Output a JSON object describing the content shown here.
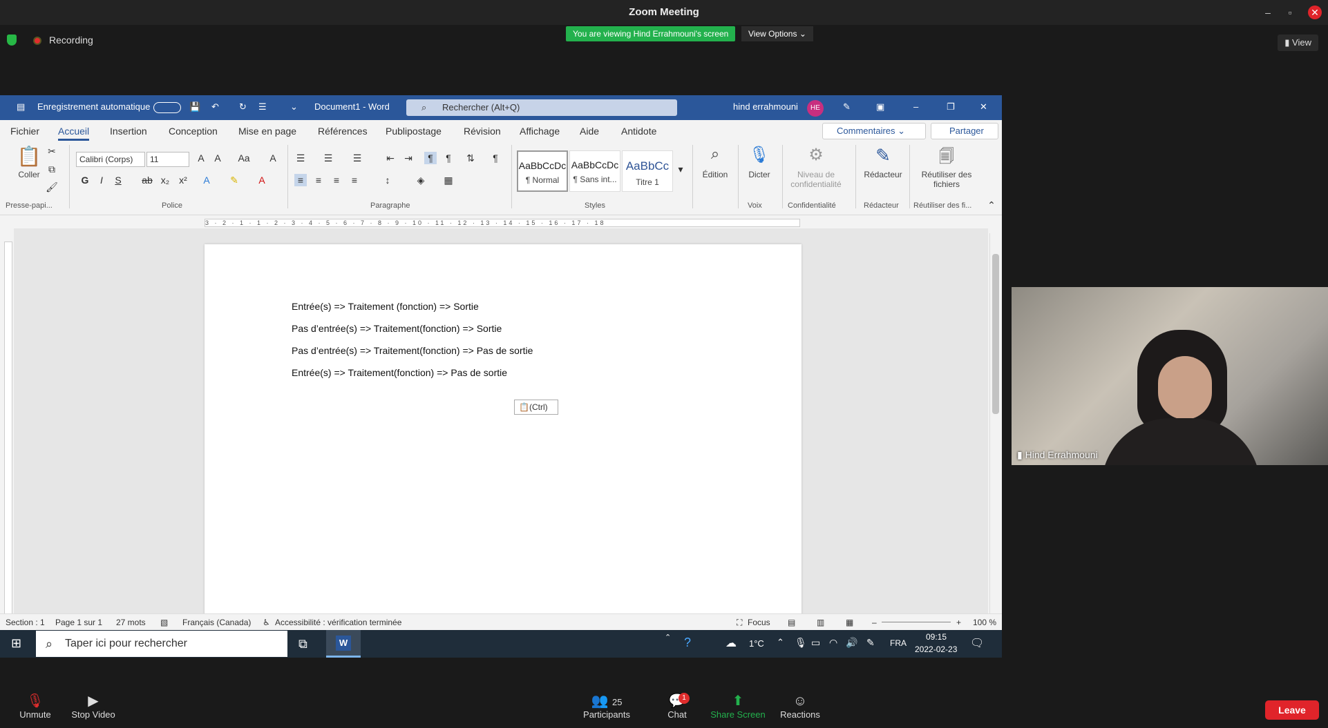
{
  "zoom": {
    "title": "Zoom Meeting",
    "recording_label": "Recording",
    "viewing_banner": "You are viewing Hind Errahmouni's screen",
    "view_options": "View Options",
    "view_top": "View",
    "participant_name": "Hind Errahmouni",
    "footer": {
      "unmute": "Unmute",
      "stop_video": "Stop Video",
      "participants": "Participants",
      "participants_count": "25",
      "chat": "Chat",
      "chat_badge": "1",
      "share_screen": "Share Screen",
      "reactions": "Reactions",
      "leave": "Leave"
    }
  },
  "word": {
    "autosave_label": "Enregistrement automatique",
    "doc_title": "Document1 - Word",
    "search_placeholder": "Rechercher (Alt+Q)",
    "user_name": "hind errahmouni",
    "user_initials": "HE",
    "tabs": [
      "Fichier",
      "Accueil",
      "Insertion",
      "Conception",
      "Mise en page",
      "Références",
      "Publipostage",
      "Révision",
      "Affichage",
      "Aide",
      "Antidote"
    ],
    "active_tab": "Accueil",
    "comments_btn": "Commentaires",
    "share_btn": "Partager",
    "ribbon": {
      "paste": "Coller",
      "clipboard_group": "Presse-papi...",
      "font_name": "Calibri (Corps)",
      "font_size": "11",
      "font_group": "Police",
      "paragraph_group": "Paragraphe",
      "styles": [
        {
          "preview": "AaBbCcDc",
          "name": "¶ Normal"
        },
        {
          "preview": "AaBbCcDc",
          "name": "¶ Sans int..."
        },
        {
          "preview": "AaBbCc",
          "name": "Titre 1"
        }
      ],
      "styles_group": "Styles",
      "editing": "Édition",
      "dictate": "Dicter",
      "voice_group": "Voix",
      "sensitivity": "Niveau de confidentialité",
      "confidentiality_group": "Confidentialité",
      "editor": "Rédacteur",
      "editor_group": "Rédacteur",
      "reuse": "Réutiliser des fichiers",
      "reuse_group": "Réutiliser des fi..."
    },
    "ruler_text": "3 · 2 · 1 · 1 · 2 · 3 · 4 · 5 · 6 · 7 · 8 · 9 · 10 · 11 · 12 · 13 · 14 · 15 · 16 · 17 · 18",
    "paragraphs": [
      "Entrée(s) => Traitement (fonction) => Sortie",
      "Pas d’entrée(s) => Traitement(fonction) => Sortie",
      "Pas d’entrée(s) => Traitement(fonction) => Pas de sortie",
      "Entrée(s) =>  Traitement(fonction) => Pas de sortie"
    ],
    "paste_options": "(Ctrl)",
    "status": {
      "section": "Section : 1",
      "page": "Page 1 sur 1",
      "words": "27 mots",
      "language": "Français (Canada)",
      "accessibility": "Accessibilité : vérification terminée",
      "focus": "Focus",
      "zoom": "100 %"
    }
  },
  "taskbar": {
    "search_placeholder": "Taper ici pour rechercher",
    "temperature": "1°C",
    "language": "FRA",
    "time": "09:15",
    "date": "2022-02-23"
  }
}
